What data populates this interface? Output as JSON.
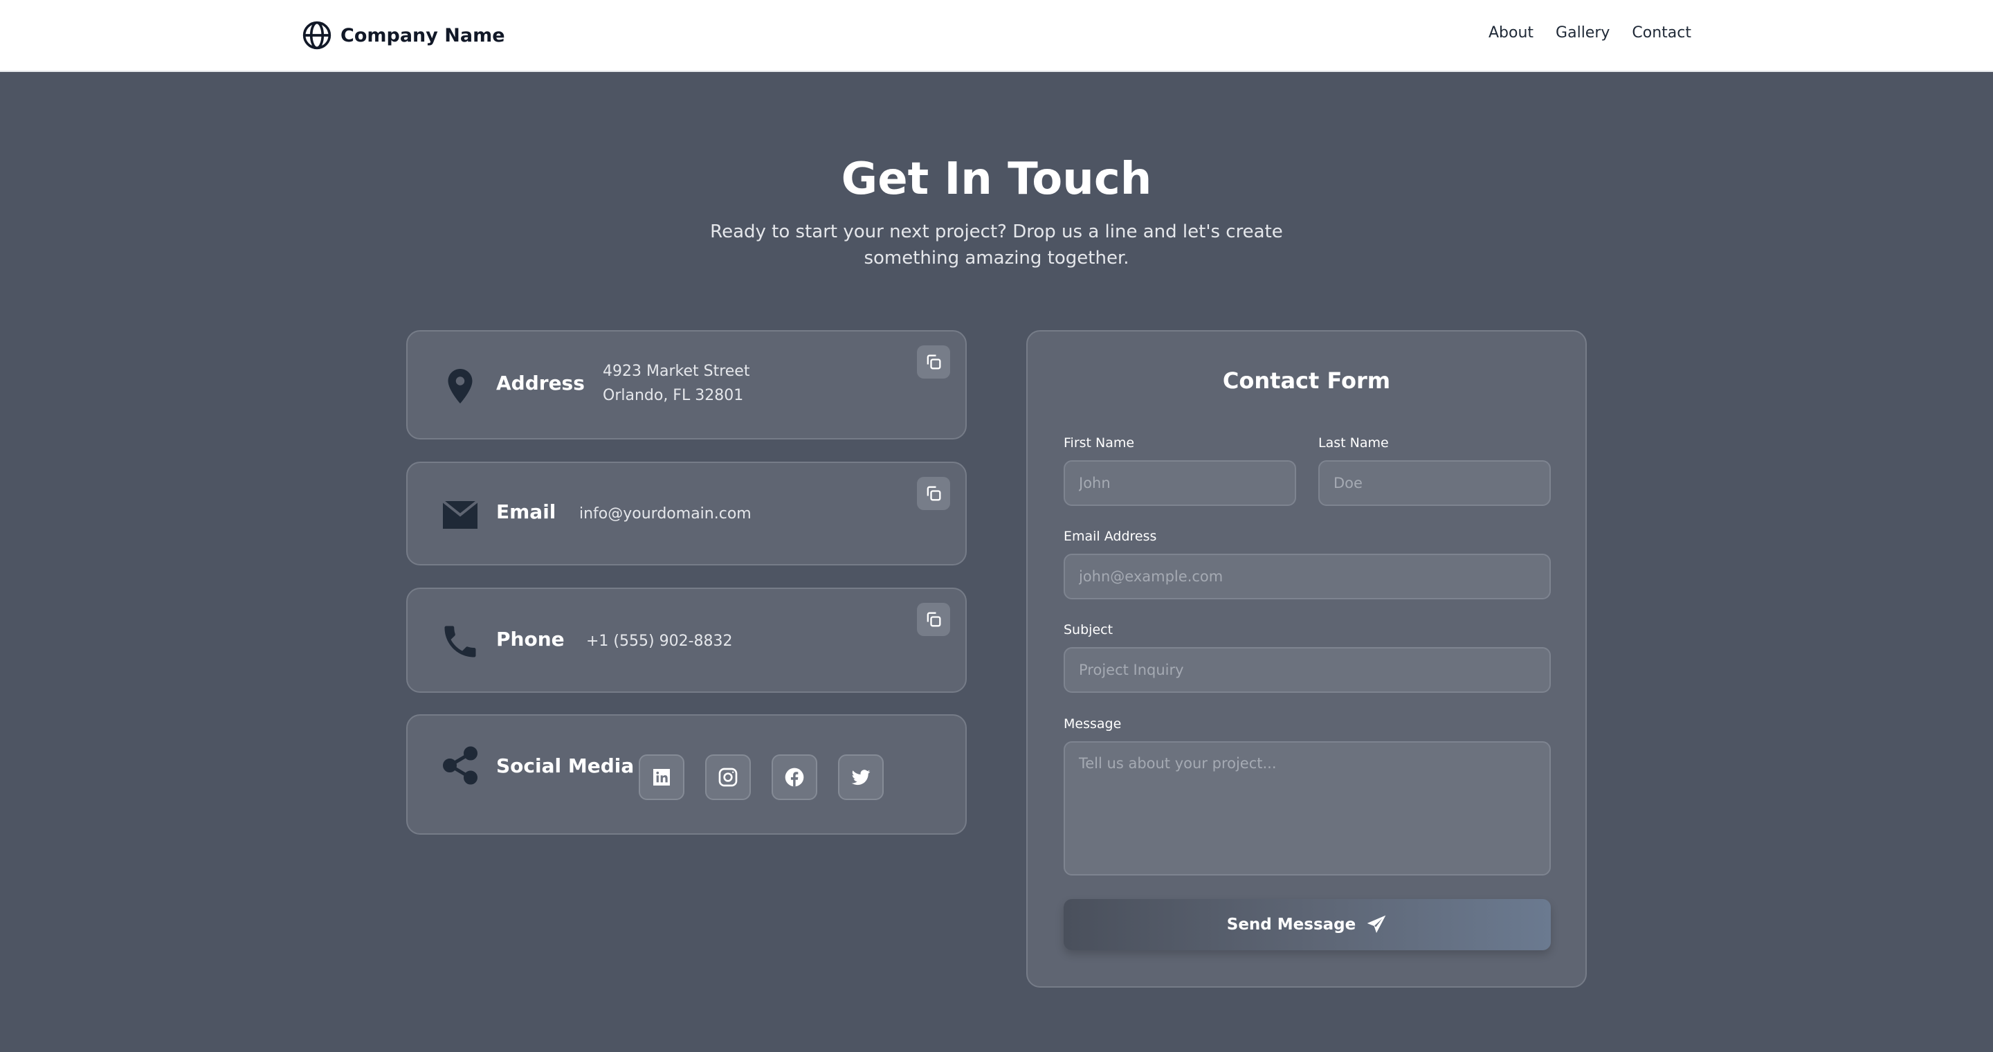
{
  "header": {
    "brand_name": "Company Name",
    "brand_icon": "globe-icon",
    "nav": [
      {
        "label": "About"
      },
      {
        "label": "Gallery"
      },
      {
        "label": "Contact"
      }
    ]
  },
  "hero": {
    "title": "Get In Touch",
    "subtitle": "Ready to start your next project? Drop us a line and let's create something amazing together."
  },
  "contact_info": {
    "address": {
      "label": "Address",
      "line1": "4923 Market Street",
      "line2": "Orlando, FL 32801",
      "icon": "map-pin-icon"
    },
    "email": {
      "label": "Email",
      "value": "info@yourdomain.com",
      "icon": "envelope-icon"
    },
    "phone": {
      "label": "Phone",
      "value": "+1 (555) 902-8832",
      "icon": "phone-icon"
    },
    "social": {
      "label": "Social Media",
      "icon": "share-icon",
      "networks": [
        "linkedin-icon",
        "instagram-icon",
        "facebook-icon",
        "twitter-icon"
      ]
    }
  },
  "form": {
    "title": "Contact Form",
    "first_name": {
      "label": "First Name",
      "placeholder": "John"
    },
    "last_name": {
      "label": "Last Name",
      "placeholder": "Doe"
    },
    "email": {
      "label": "Email Address",
      "placeholder": "john@example.com"
    },
    "subject": {
      "label": "Subject",
      "placeholder": "Project Inquiry"
    },
    "message": {
      "label": "Message",
      "placeholder": "Tell us about your project..."
    },
    "submit_label": "Send Message"
  },
  "colors": {
    "background": "#4e5563",
    "card": "#5f6572",
    "header": "#ffffff",
    "icon_dark": "#1f2937"
  }
}
